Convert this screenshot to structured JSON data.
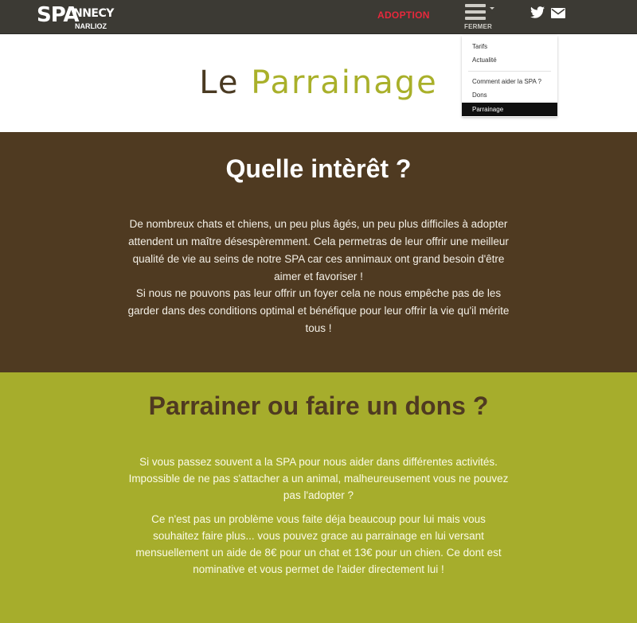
{
  "header": {
    "logo": {
      "big": "SPA",
      "side": "NNECY",
      "sub": "NARLIOZ"
    },
    "nav": {
      "adoption": "ADOPTION",
      "menu_label": "FERMER"
    },
    "social": {
      "twitter": "twitter-icon",
      "mail": "mail-icon"
    }
  },
  "dropdown": {
    "items": [
      "Tarifs",
      "Actualité",
      "Comment aider la SPA ?",
      "Dons",
      "Parrainage"
    ],
    "active": "Parrainage"
  },
  "hero": {
    "title_part1": "Le ",
    "title_part2": "Parrainage"
  },
  "section_interet": {
    "heading": "Quelle intèrêt ?",
    "p1": "De nombreux chats et chiens, un peu plus âgés, un peu plus difficiles à adopter attendent un maître désespèremment. Cela permetras de leur offrir une meilleur qualité de vie au seins de notre SPA car ces annimaux ont grand besoin d'être aimer et favoriser !",
    "p2": "Si nous ne pouvons pas leur offrir un foyer cela ne nous empêche pas de les garder dans des conditions optimal et bénéfique pour leur offrir la vie qu'il mérite tous !"
  },
  "section_dons": {
    "heading": "Parrainer ou faire un dons ?",
    "p1": "Si vous passez souvent a la SPA pour nous aider dans différentes activités. Impossible de ne pas s'attacher a un animal, malheureusement vous ne pouvez pas l'adopter ?",
    "p2": "Ce n'est pas un problème vous faite déja beaucoup pour lui mais vous souhaitez faire plus... vous pouvez grace au parrainage en lui versant mensuellement un aide de 8€ pour un chat et 13€ pour un chien. Ce dont est nominative et vous permet de l'aider directement lui !"
  },
  "colors": {
    "topbar": "#3c3a34",
    "adoption_red": "#e8283c",
    "brown": "#4f3a21",
    "green": "#a6ad2c",
    "title_accent": "#a9b02a"
  }
}
